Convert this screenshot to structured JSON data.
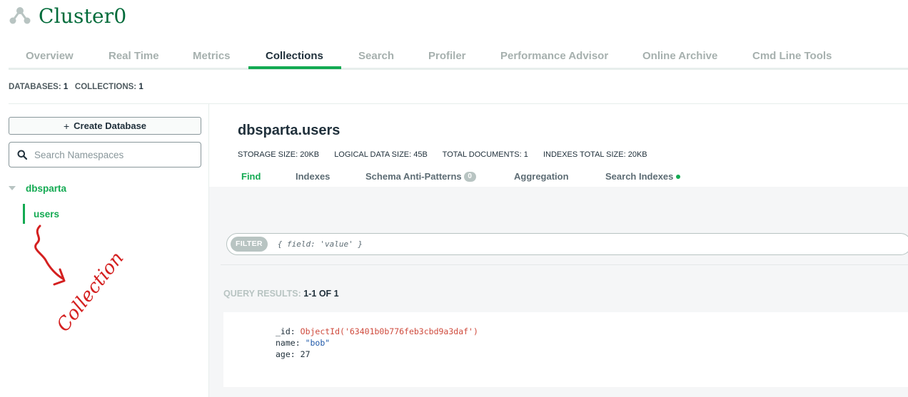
{
  "header": {
    "cluster_name": "Cluster0",
    "cluster_icon": "cluster-nodes-icon",
    "accent_color": "#13aa52",
    "title_color": "#016b3a"
  },
  "tabs": [
    {
      "label": "Overview",
      "active": false
    },
    {
      "label": "Real Time",
      "active": false
    },
    {
      "label": "Metrics",
      "active": false
    },
    {
      "label": "Collections",
      "active": true
    },
    {
      "label": "Search",
      "active": false
    },
    {
      "label": "Profiler",
      "active": false
    },
    {
      "label": "Performance Advisor",
      "active": false
    },
    {
      "label": "Online Archive",
      "active": false
    },
    {
      "label": "Cmd Line Tools",
      "active": false
    }
  ],
  "summary": {
    "databases_label": "DATABASES:",
    "databases_value": "1",
    "collections_label": "COLLECTIONS:",
    "collections_value": "1"
  },
  "sidebar": {
    "create_database_label": "Create Database",
    "search_placeholder": "Search Namespaces",
    "database": "dbsparta",
    "collection": "users",
    "annotation_text": "Collection"
  },
  "collection": {
    "title": "dbsparta.users",
    "stats": [
      "STORAGE SIZE: 20KB",
      "LOGICAL DATA SIZE: 45B",
      "TOTAL DOCUMENTS: 1",
      "INDEXES TOTAL SIZE: 20KB"
    ],
    "sub_tabs": [
      {
        "label": "Find",
        "active": true
      },
      {
        "label": "Indexes",
        "active": false
      },
      {
        "label": "Schema Anti-Patterns",
        "badge": "0",
        "active": false
      },
      {
        "label": "Aggregation",
        "active": false
      },
      {
        "label": "Search Indexes",
        "dot": true,
        "active": false
      }
    ]
  },
  "filter": {
    "button_label": "FILTER",
    "placeholder": "{ field: 'value' }"
  },
  "results": {
    "label": "QUERY RESULTS:",
    "count": "1-1 OF 1"
  },
  "document": {
    "id_key": "_id:",
    "id_value": "ObjectId('63401b0b776feb3cbd9a3daf')",
    "name_key": "name:",
    "name_value": "\"bob\"",
    "age_key": "age:",
    "age_value": "27"
  }
}
